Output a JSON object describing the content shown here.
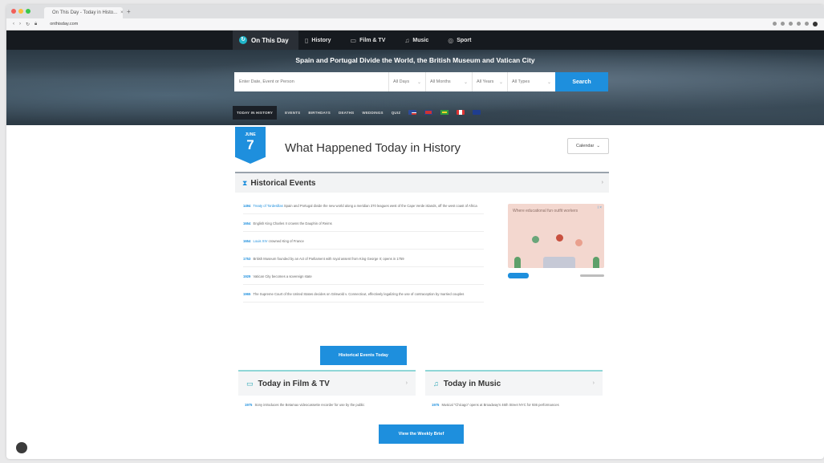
{
  "browser": {
    "tab_title": "On This Day - Today in Histo...",
    "tab_close": "×",
    "new_tab": "+",
    "url": "onthisday.com",
    "traffic_colors": [
      "#f25f58",
      "#fbbe3c",
      "#39c84b"
    ]
  },
  "nav": {
    "brand": "On This Day",
    "items": [
      {
        "label": "History",
        "icon": "book-icon"
      },
      {
        "label": "Film & TV",
        "icon": "film-icon"
      },
      {
        "label": "Music",
        "icon": "music-note-icon"
      },
      {
        "label": "Sport",
        "icon": "ball-icon"
      }
    ]
  },
  "hero": {
    "headline": "Spain and Portugal Divide the World, the British Museum and Vatican City",
    "search_placeholder": "Enter Date, Event or Person",
    "selects": [
      {
        "value": "All Days",
        "icon": "chevron-down-icon"
      },
      {
        "value": "All Months",
        "icon": "chevron-down-icon"
      },
      {
        "value": "All Years",
        "icon": "chevron-down-icon"
      },
      {
        "value": "All Types",
        "icon": "chevron-down-icon"
      }
    ],
    "search_button": "Search"
  },
  "subnav": {
    "items": [
      "TODAY IN HISTORY",
      "EVENTS",
      "BIRTHDAYS",
      "DEATHS",
      "WEDDINGS",
      "QUIZ"
    ]
  },
  "main": {
    "month": "JUNE",
    "day": "7",
    "heading": "What Happened Today in History",
    "calendar_label": "Calendar",
    "calendar_icon": "chevron-down-icon"
  },
  "historical": {
    "title": "Historical Events",
    "chevron": "›",
    "events": [
      {
        "year": "1494",
        "link": "Treaty of Tordesillas",
        "text": "Spain and Portugal divide the new world along a meridian 370 leagues west of the Cape Verde islands, off the west coast of Africa"
      },
      {
        "year": "1654",
        "link": "",
        "text": "English King Charles II crowns the Dauphin of Reims"
      },
      {
        "year": "1654",
        "link": "Louis XIV",
        "text": "crowned King of France"
      },
      {
        "year": "1753",
        "link": "",
        "text": "British Museum founded by an Act of Parliament with royal assent from King George II; opens in 1759"
      },
      {
        "year": "1929",
        "link": "",
        "text": "Vatican City becomes a sovereign state"
      },
      {
        "year": "1965",
        "link": "",
        "text": "The Supreme Court of the United States decides on Griswold v. Connecticut, effectively legalizing the use of contraception by married couples"
      }
    ],
    "more_button": "Historical Events Today"
  },
  "ad": {
    "text": "Where educational fun outfit workers",
    "info": "i ×"
  },
  "film": {
    "title": "Today in Film & TV",
    "chevron": "›",
    "year": "1975",
    "text": "Sony introduces the Betamax videocassette recorder for use by the public"
  },
  "music": {
    "title": "Today in Music",
    "chevron": "›",
    "year": "1975",
    "text": "Musical \"Chicago\" opens at Broadway's 46th Street NYC for 936 performances"
  },
  "weekly_button": "View the Weekly Brief"
}
